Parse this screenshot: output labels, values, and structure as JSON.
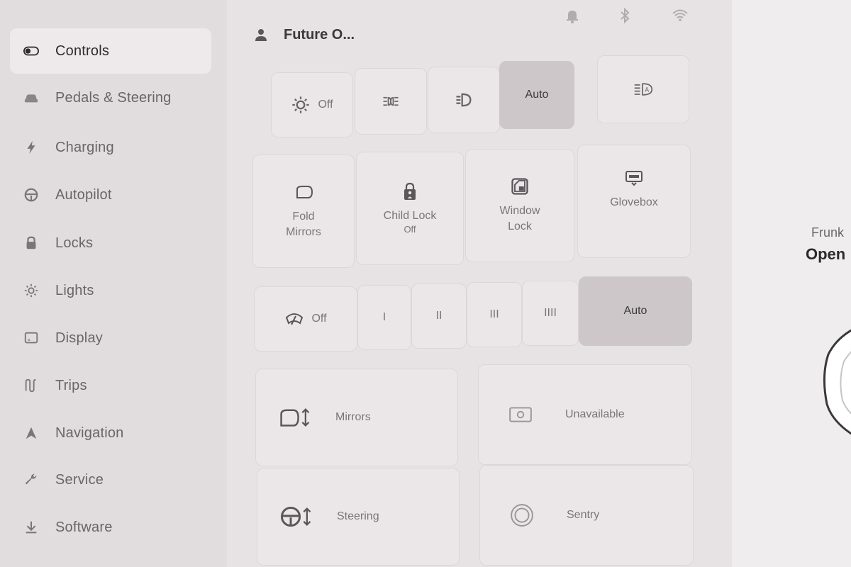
{
  "sidebar": {
    "items": [
      {
        "label": "Controls",
        "icon": "toggle-icon",
        "active": true
      },
      {
        "label": "Pedals & Steering",
        "icon": "car-icon"
      },
      {
        "label": "Charging",
        "icon": "lightning-icon"
      },
      {
        "label": "Autopilot",
        "icon": "steering-wheel-icon"
      },
      {
        "label": "Locks",
        "icon": "lock-icon"
      },
      {
        "label": "Lights",
        "icon": "sun-icon"
      },
      {
        "label": "Display",
        "icon": "display-icon"
      },
      {
        "label": "Trips",
        "icon": "trips-icon"
      },
      {
        "label": "Navigation",
        "icon": "navigation-icon"
      },
      {
        "label": "Service",
        "icon": "wrench-icon"
      },
      {
        "label": "Software",
        "icon": "download-icon"
      }
    ]
  },
  "header": {
    "profile_name": "Future O...",
    "status_icons": [
      "bell-icon",
      "bluetooth-icon",
      "wifi-icon"
    ]
  },
  "lights": {
    "off_label": "Off",
    "auto_label": "Auto",
    "selected": "Auto"
  },
  "quick_controls": {
    "fold_mirrors": "Fold\nMirrors",
    "child_lock": "Child Lock",
    "child_lock_state": "Off",
    "window_lock": "Window\nLock",
    "glovebox": "Glovebox"
  },
  "wipers": {
    "off_label": "Off",
    "speeds": [
      "I",
      "II",
      "III",
      "IIII"
    ],
    "auto_label": "Auto",
    "selected": "Auto"
  },
  "adjust": {
    "mirrors": "Mirrors",
    "steering": "Steering",
    "unavailable": "Unavailable",
    "sentry": "Sentry"
  },
  "car": {
    "frunk_label": "Frunk",
    "frunk_value": "Open"
  },
  "colors": {
    "selected_tile": "#cdc7ca",
    "background": "#e7e3e5"
  }
}
